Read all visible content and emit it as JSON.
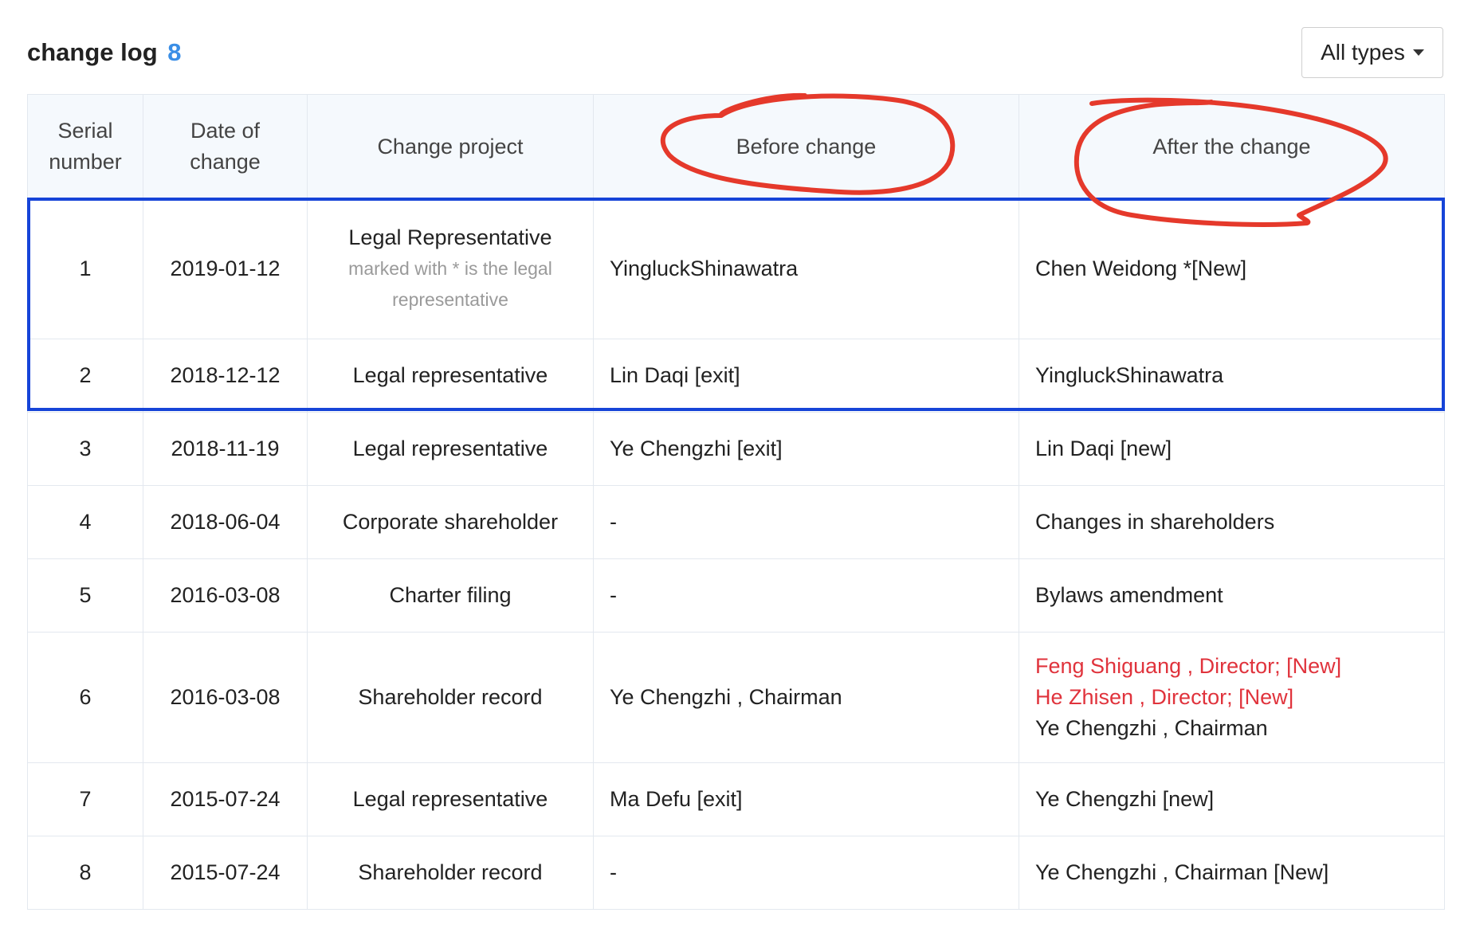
{
  "header": {
    "title": "change log",
    "count": "8",
    "filter_label": "All types"
  },
  "columns": {
    "serial": [
      "Serial",
      "number"
    ],
    "date": [
      "Date of",
      "change"
    ],
    "project": "Change project",
    "before": "Before change",
    "after": "After the change"
  },
  "rows": [
    {
      "serial": "1",
      "date": "2019-01-12",
      "project": "Legal Representative",
      "project_note": "marked with * is the legal representative",
      "before": "YingluckShinawatra",
      "after": "Chen Weidong *[New]"
    },
    {
      "serial": "2",
      "date": "2018-12-12",
      "project": "Legal representative",
      "before": "Lin Daqi [exit]",
      "after": "YingluckShinawatra"
    },
    {
      "serial": "3",
      "date": "2018-11-19",
      "project": "Legal representative",
      "before": "Ye Chengzhi [exit]",
      "after": "Lin Daqi [new]"
    },
    {
      "serial": "4",
      "date": "2018-06-04",
      "project": "Corporate shareholder",
      "before": "-",
      "after": "Changes in shareholders"
    },
    {
      "serial": "5",
      "date": "2016-03-08",
      "project": "Charter filing",
      "before": "-",
      "after": "Bylaws amendment"
    },
    {
      "serial": "6",
      "date": "2016-03-08",
      "project": "Shareholder record",
      "before": "Ye Chengzhi , Chairman",
      "after_lines": [
        "Feng Shiguang , Director; [New]",
        "He Zhisen , Director; [New]",
        "Ye Chengzhi , Chairman"
      ]
    },
    {
      "serial": "7",
      "date": "2015-07-24",
      "project": "Legal representative",
      "before": "Ma Defu [exit]",
      "after": "Ye Chengzhi [new]"
    },
    {
      "serial": "8",
      "date": "2015-07-24",
      "project": "Shareholder record",
      "before": "-",
      "after": "Ye Chengzhi , Chairman [New]"
    }
  ],
  "colors": {
    "accent_count": "#3a8ee6",
    "changed_text": "#e0333c",
    "highlight_box": "#1644d8",
    "annotation_circle": "#e5392b"
  }
}
